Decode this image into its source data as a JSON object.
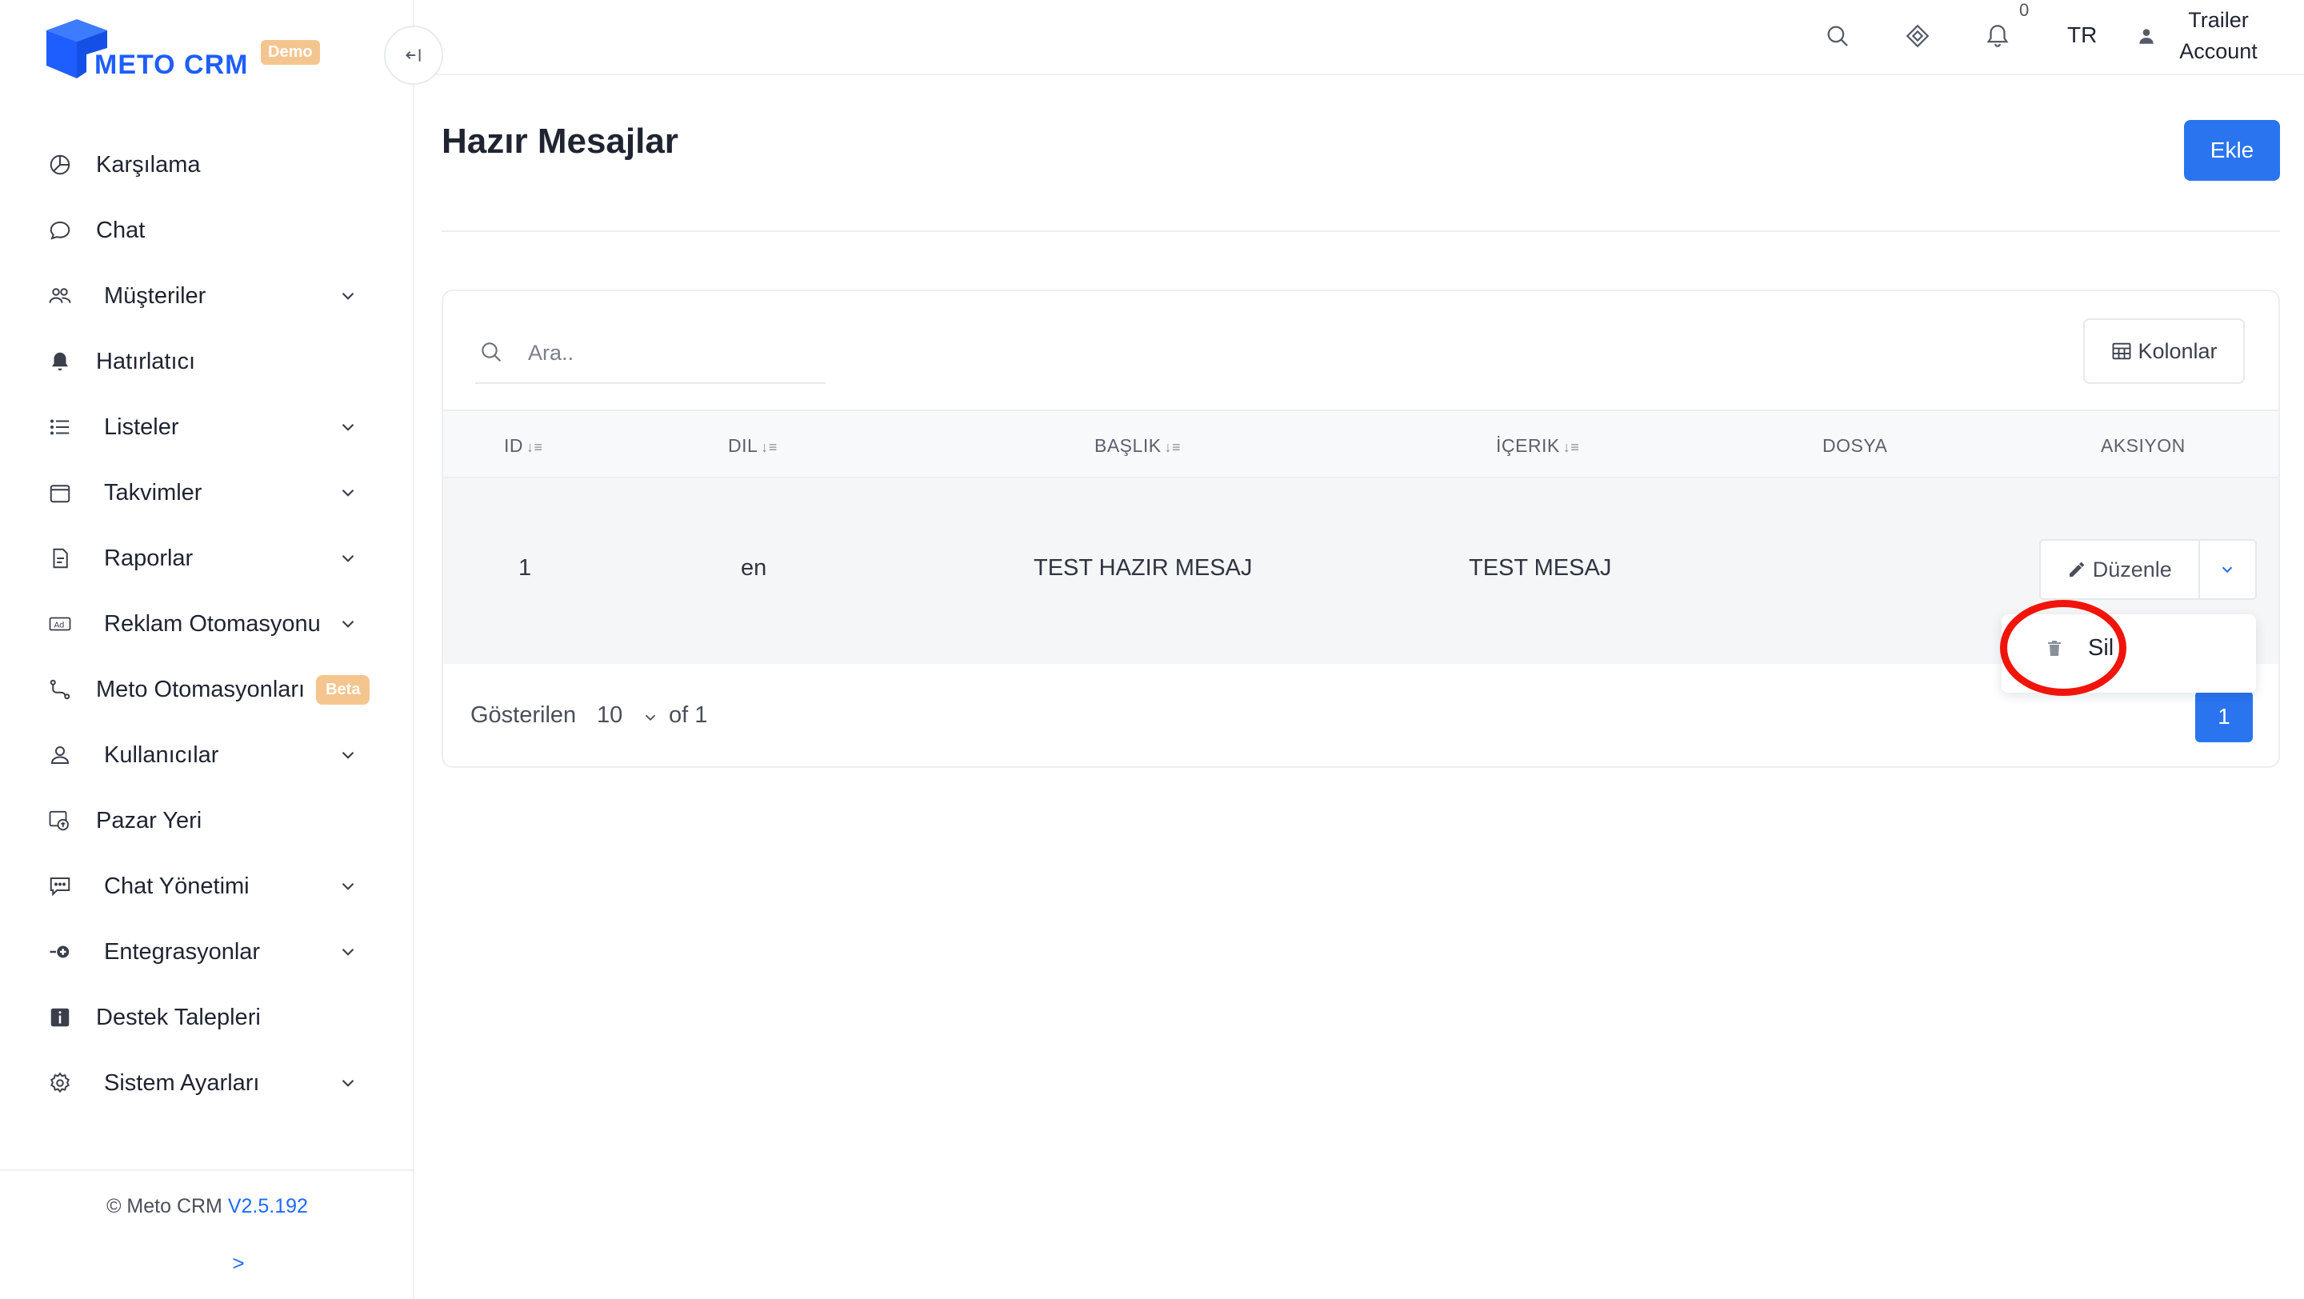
{
  "brand": {
    "name": "METO CRM",
    "badge": "Demo",
    "color": "#1e5eff"
  },
  "sidebar": {
    "items": [
      {
        "label": "Karşılama",
        "icon": "pie-chart-icon",
        "has_sub": false
      },
      {
        "label": "Chat",
        "icon": "chat-bubble-icon",
        "has_sub": false
      },
      {
        "label": "Müşteriler",
        "icon": "users-icon",
        "has_sub": true
      },
      {
        "label": "Hatırlatıcı",
        "icon": "bell-icon",
        "has_sub": false
      },
      {
        "label": "Listeler",
        "icon": "list-icon",
        "has_sub": true
      },
      {
        "label": "Takvimler",
        "icon": "calendar-icon",
        "has_sub": true
      },
      {
        "label": "Raporlar",
        "icon": "document-icon",
        "has_sub": true
      },
      {
        "label": "Reklam Otomasyonu",
        "icon": "ad-icon",
        "has_sub": true
      },
      {
        "label": "Meto Otomasyonları",
        "icon": "flow-icon",
        "has_sub": false,
        "badge": "Beta"
      },
      {
        "label": "Kullanıcılar",
        "icon": "user-icon",
        "has_sub": true
      },
      {
        "label": "Pazar Yeri",
        "icon": "marketplace-icon",
        "has_sub": false
      },
      {
        "label": "Chat Yönetimi",
        "icon": "chat-settings-icon",
        "has_sub": true
      },
      {
        "label": "Entegrasyonlar",
        "icon": "plug-icon",
        "has_sub": true
      },
      {
        "label": "Destek Talepleri",
        "icon": "info-icon",
        "has_sub": false
      },
      {
        "label": "Sistem Ayarları",
        "icon": "gear-icon",
        "has_sub": true
      }
    ],
    "footer": {
      "copyright": "© Meto CRM",
      "version": "V2.5.192",
      "expand": ">"
    }
  },
  "topbar": {
    "notification_count": "0",
    "language": "TR",
    "user_line1": "Trailer",
    "user_line2": "Account"
  },
  "page": {
    "title": "Hazır Mesajlar",
    "add_label": "Ekle"
  },
  "table": {
    "search_placeholder": "Ara..",
    "columns_label": "Kolonlar",
    "headers": [
      "ID",
      "DIL",
      "BAŞLIK",
      "İÇERIK",
      "DOSYA",
      "AKSIYON"
    ],
    "rows": [
      {
        "id": "1",
        "lang": "en",
        "title": "TEST HAZIR MESAJ",
        "content": "TEST MESAJ",
        "file": ""
      }
    ],
    "edit_label": "Düzenle",
    "delete_label": "Sil",
    "footer": {
      "shown_label": "Gösterilen",
      "page_size": "10",
      "of_label": "of 1",
      "current_page": "1"
    }
  },
  "colors": {
    "accent": "#2a74f0",
    "badge": "#f5c58f",
    "highlight": "#f0140a"
  }
}
